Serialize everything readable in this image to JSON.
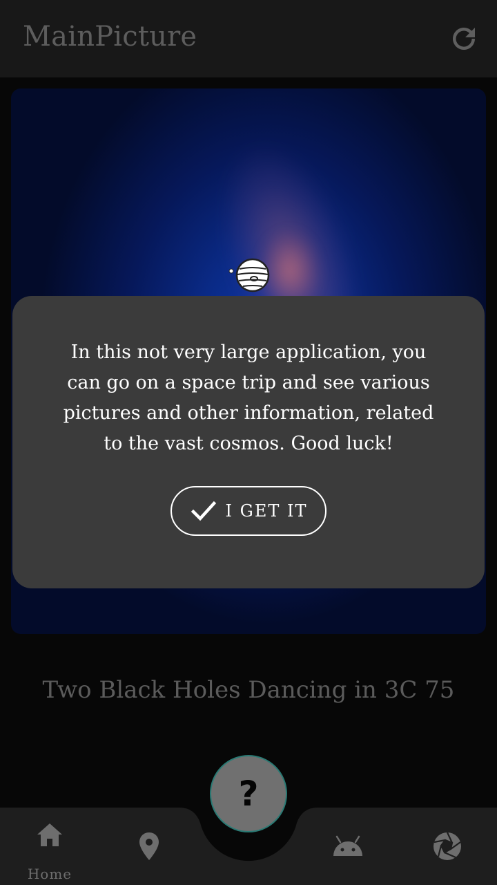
{
  "app_bar": {
    "title": "MainPicture",
    "refresh_icon": "refresh-icon"
  },
  "picture": {
    "caption": "Two Black Holes Dancing in 3C 75"
  },
  "dialog": {
    "message": "In this not very large application, you can go on a space trip and see various pictures and other information, related to the vast cosmos. Good luck!",
    "button_label": "I GET IT",
    "icons": {
      "planet": "planet-icon",
      "check": "check-icon"
    }
  },
  "fab": {
    "label": "?"
  },
  "bottom_nav": {
    "items": [
      {
        "label": "Home",
        "icon": "home-icon",
        "active": true
      },
      {
        "label": "",
        "icon": "location-pin-icon",
        "active": false
      },
      {
        "label": "",
        "icon": "android-icon",
        "active": false
      },
      {
        "label": "",
        "icon": "camera-aperture-icon",
        "active": false
      }
    ]
  },
  "colors": {
    "background": "#070707",
    "app_bar": "#181818",
    "dialog": "#3b3b3b",
    "nav_bar": "#1e1e1e",
    "fab": "#707070",
    "fab_border": "#2a7a74"
  }
}
